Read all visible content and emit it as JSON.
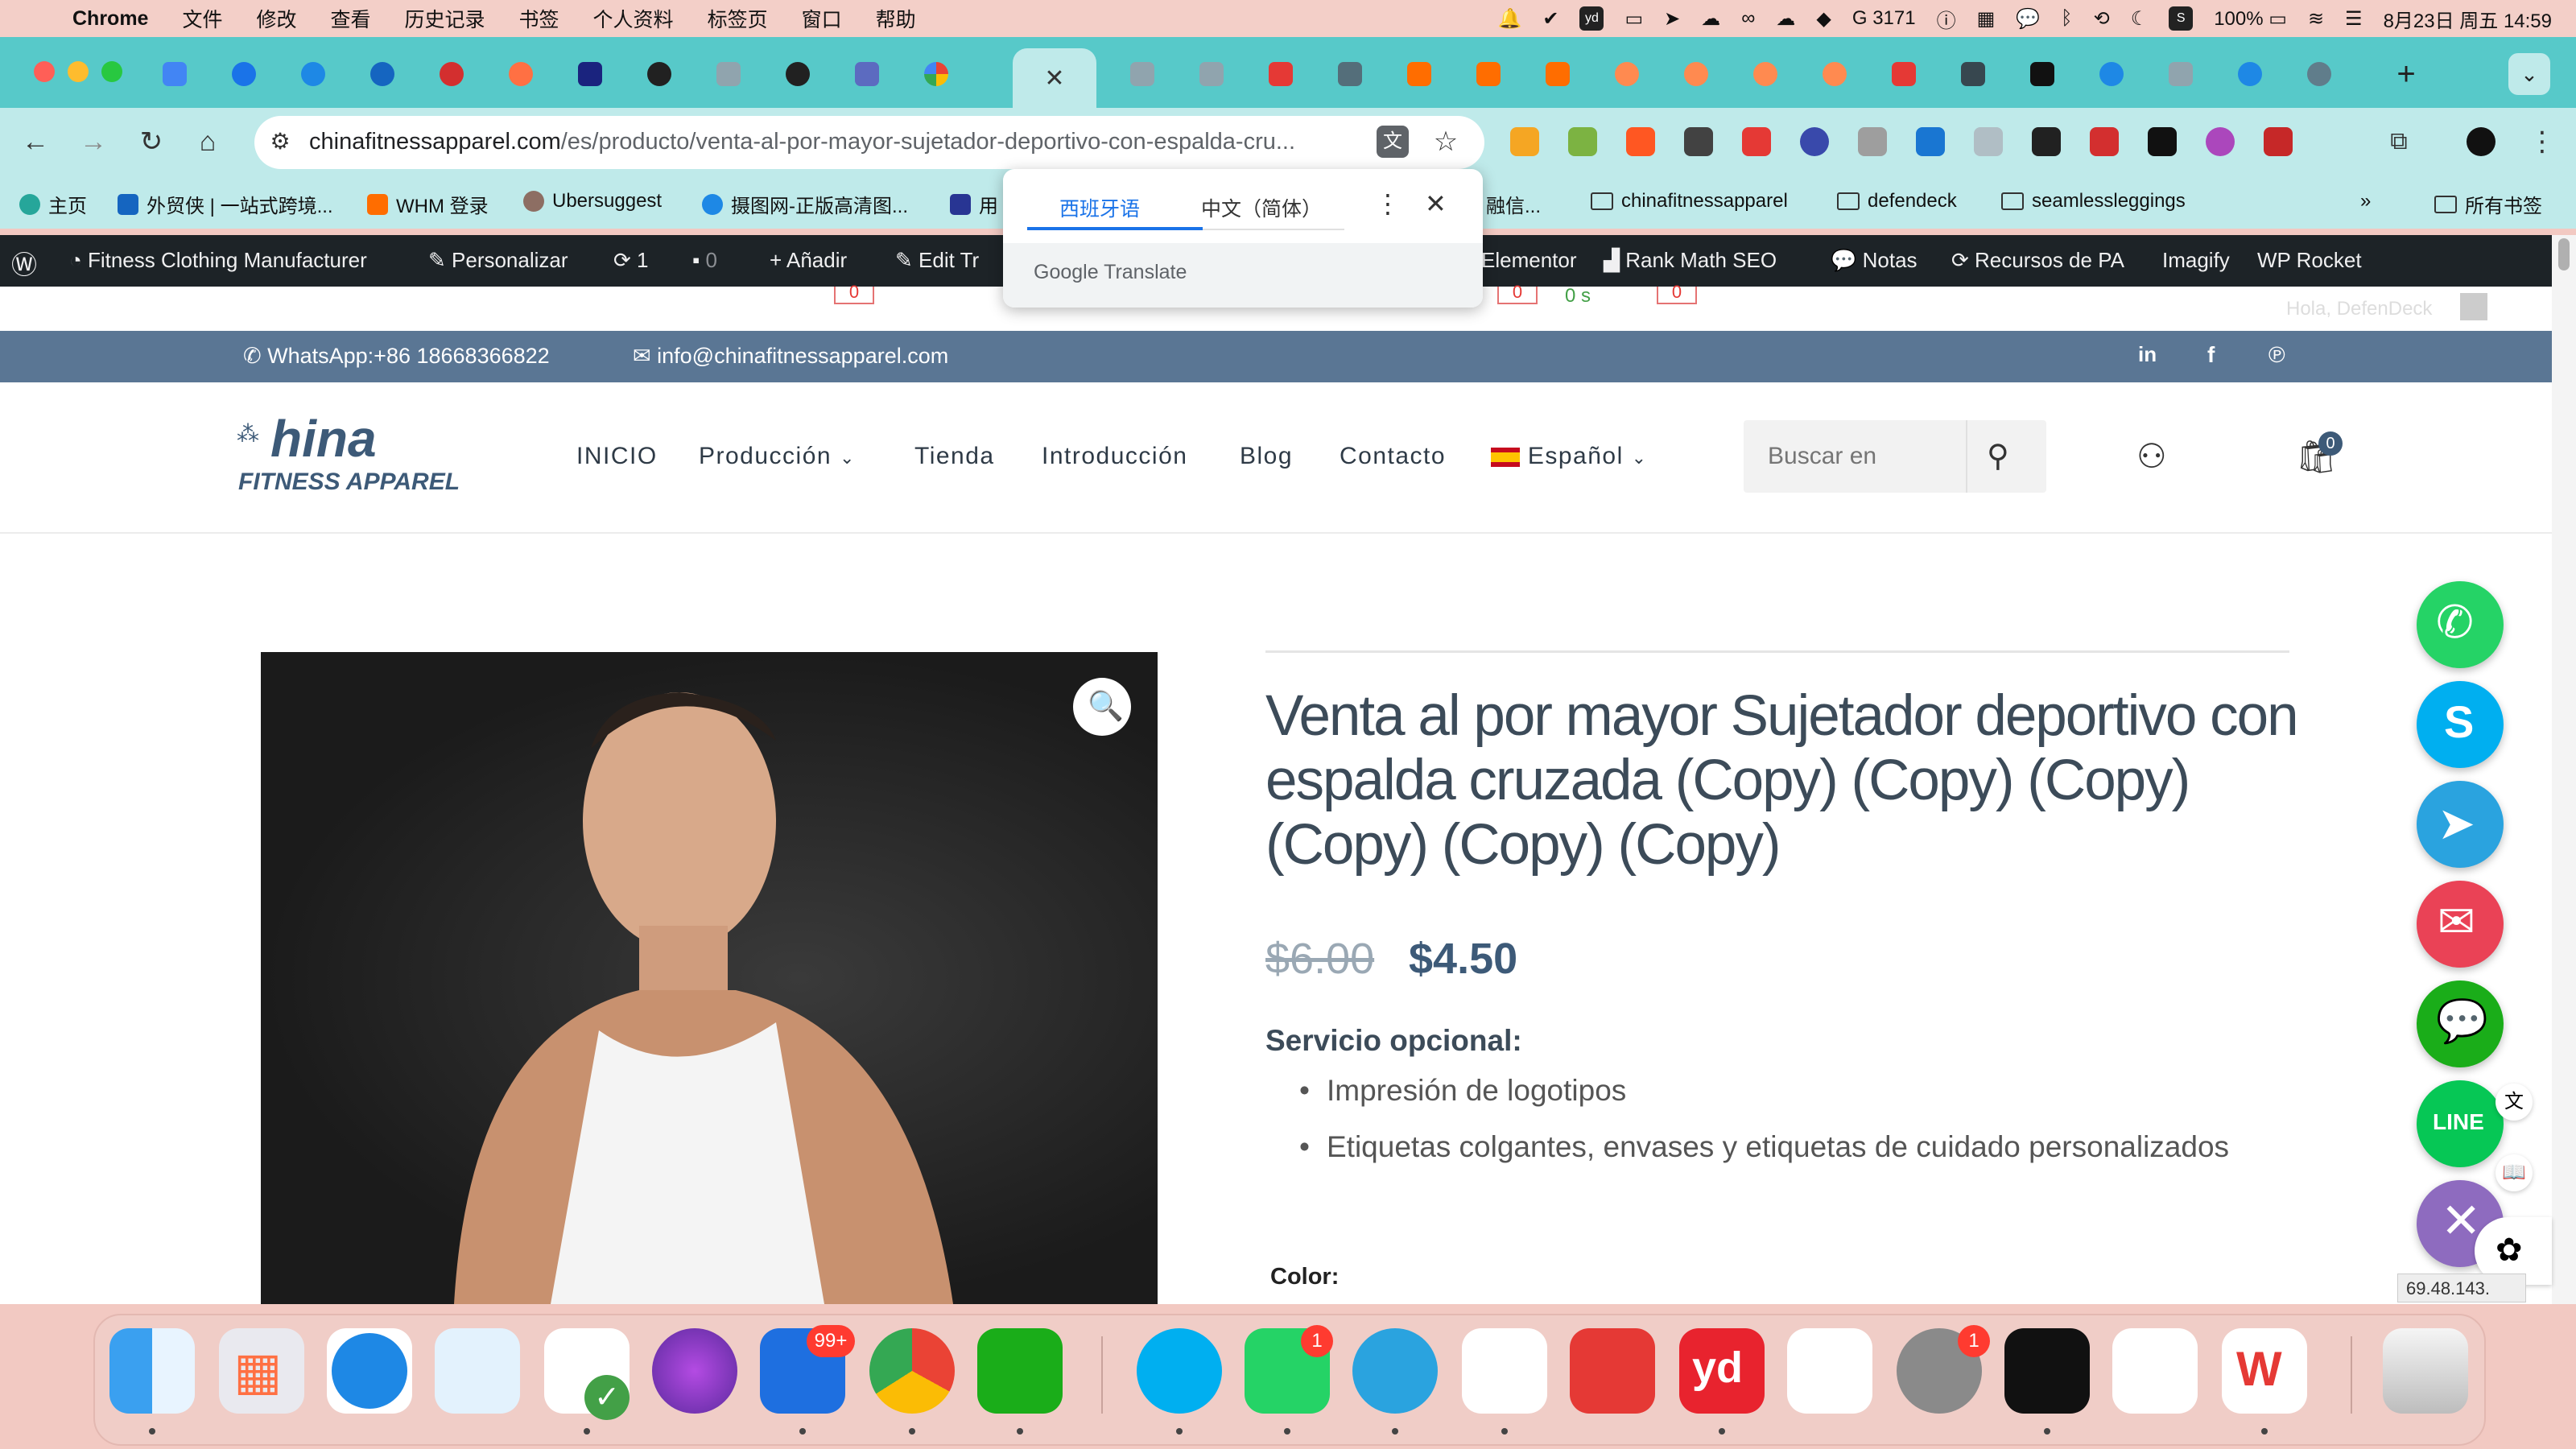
{
  "menubar": {
    "app": "Chrome",
    "items": [
      "文件",
      "修改",
      "查看",
      "历史记录",
      "书签",
      "个人资料",
      "标签页",
      "窗口",
      "帮助"
    ],
    "status": {
      "counter": "3171",
      "battery": "100%",
      "datetime": "8月23日 周五 14:59"
    }
  },
  "browser": {
    "url_domain": "chinafitnessapparel.com",
    "url_path": "/es/producto/venta-al-por-mayor-sujetador-deportivo-con-espalda-cru...",
    "bookmarks": [
      "主页",
      "外贸侠 | 一站式跨境...",
      "WHM 登录",
      "Ubersuggest",
      "摄图网-正版高清图...",
      "用",
      "融信...",
      "chinafitnessapparel",
      "defendeck",
      "seamlessleggings",
      "所有书签"
    ]
  },
  "translate": {
    "tab_source": "西班牙语",
    "tab_target": "中文（简体）",
    "brand": "Google Translate"
  },
  "wpbar": {
    "site": "Fitness Clothing Manufacturer",
    "customize": "Personalizar",
    "updates": "1",
    "comments": "0",
    "new": "Añadir",
    "edit": "Edit Tr",
    "elementor": "Elementor",
    "rankmath": "Rank Math SEO",
    "notes": "Notas",
    "pa": "Recursos de PA",
    "imagify": "Imagify",
    "wprocket": "WP Rocket",
    "greeting": "Hola, DefenDeck",
    "speed_a": "0",
    "speed_b": "0",
    "speed_c": "0 s",
    "speed_d": "0"
  },
  "topbar": {
    "whatsapp": "WhatsApp:+86 18668366822",
    "email": "info@chinafitnessapparel.com"
  },
  "header": {
    "logo_top": "hina",
    "logo_bottom": "FITNESS APPAREL",
    "nav": [
      "INICIO",
      "Producción",
      "Tienda",
      "Introducción",
      "Blog",
      "Contacto",
      "Español"
    ],
    "search_placeholder": "Buscar en",
    "cart_count": "0"
  },
  "product": {
    "title": "Venta al por mayor Sujetador deportivo con espalda cruzada (Copy) (Copy) (Copy) (Copy) (Copy) (Copy)",
    "price_old": "$6.00",
    "price_new": "$4.50",
    "service_label": "Servicio opcional:",
    "services": [
      "Impresión de logotipos",
      "Etiquetas colgantes, envases y etiquetas de cuidado personalizados"
    ],
    "color_label": "Color:"
  },
  "misc": {
    "ip_badge": "69.48.143.",
    "float_line": "LINE"
  },
  "dock": {
    "badges": {
      "feishu": "99+",
      "whatsapp": "1",
      "settings": "1"
    }
  },
  "colors": {
    "tabstrip": "#57c9c9",
    "toolbar": "#bfeaea",
    "topbar": "#5a7694",
    "price_new": "#3d5a78"
  }
}
